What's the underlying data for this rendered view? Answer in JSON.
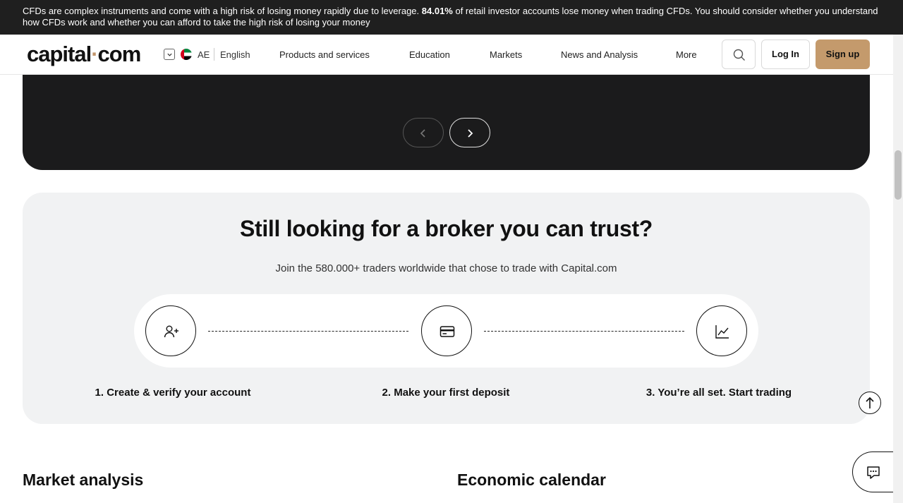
{
  "risk_banner": {
    "text_before": "CFDs are complex instruments and come with a high risk of losing money rapidly due to leverage. ",
    "percent": "84.01%",
    "text_after": " of retail investor accounts lose money when trading CFDs. You should consider whether you understand how CFDs work and whether you can afford to take the high risk of losing your money"
  },
  "header": {
    "logo_main": "capital",
    "logo_dot": "·",
    "logo_tld": "com",
    "country_code": "AE",
    "language": "English",
    "nav": [
      "Products and services",
      "Education",
      "Markets",
      "News and Analysis",
      "More"
    ],
    "login_label": "Log In",
    "signup_label": "Sign up"
  },
  "trust": {
    "title": "Still looking for a broker you can trust?",
    "subtitle": "Join the 580.000+ traders worldwide that chose to trade with Capital.com",
    "steps": [
      {
        "label": "1. Create & verify your account",
        "icon": "user-plus-icon"
      },
      {
        "label": "2. Make your first deposit",
        "icon": "credit-card-icon"
      },
      {
        "label": "3. You’re all set. Start trading",
        "icon": "chart-line-icon"
      }
    ]
  },
  "sections": {
    "market_analysis": "Market analysis",
    "economic_calendar": "Economic calendar"
  },
  "colors": {
    "accent": "#c49a6c",
    "dark_panel": "#1b1b1c",
    "trust_bg": "#f1f2f3"
  }
}
